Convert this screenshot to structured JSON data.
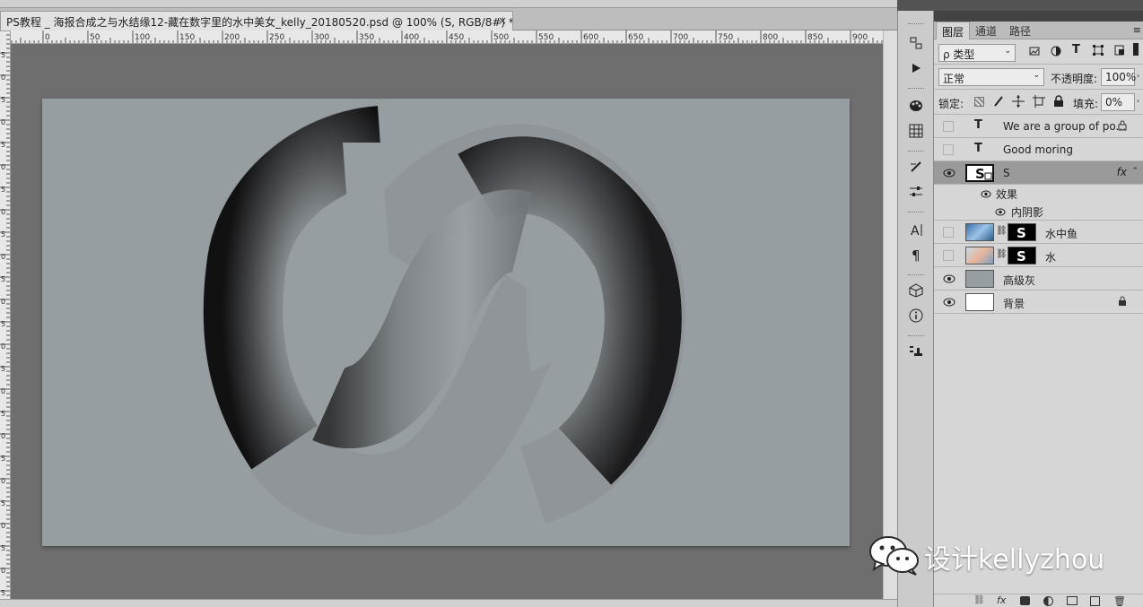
{
  "document": {
    "tab_title": "PS教程 _ 海报合成之与水结缘12-藏在数字里的水中美女_kelly_20180520.psd @ 100% (S, RGB/8#) *",
    "tab_close": "×"
  },
  "ruler": {
    "h_ticks": [
      "0",
      "50",
      "100",
      "150",
      "200",
      "250",
      "300",
      "350",
      "400",
      "450",
      "500",
      "550",
      "600",
      "650",
      "700",
      "750",
      "800",
      "850",
      "900"
    ],
    "v_ticks": [
      "5",
      "0",
      "5",
      "0",
      "5",
      "0",
      "5",
      "0",
      "5",
      "0",
      "5",
      "0",
      "5",
      "0",
      "5",
      "0",
      "5",
      "0",
      "5",
      "0",
      "5",
      "0",
      "5",
      "0",
      "5",
      "0"
    ]
  },
  "panel": {
    "tabs": [
      "图层",
      "通道",
      "路径"
    ],
    "filter_label": "ρ 类型",
    "blend_mode": "正常",
    "opacity_label": "不透明度:",
    "opacity_value": "100%",
    "lock_label": "锁定:",
    "fill_label": "填充:",
    "fill_value": "0%",
    "layers": [
      {
        "name": "We are a group of po...",
        "kind": "text",
        "visible": false,
        "locked": true
      },
      {
        "name": "Good moring",
        "kind": "text",
        "visible": false,
        "locked": false
      },
      {
        "name": "S",
        "kind": "smart",
        "visible": true,
        "selected": true,
        "fx": "fx"
      },
      {
        "name": "效果",
        "kind": "effects",
        "visible": true
      },
      {
        "name": "内阴影",
        "kind": "effect",
        "visible": true
      },
      {
        "name": "水中鱼",
        "kind": "masked",
        "visible": false
      },
      {
        "name": "水",
        "kind": "masked",
        "visible": false
      },
      {
        "name": "高级灰",
        "kind": "fill",
        "visible": true
      },
      {
        "name": "背景",
        "kind": "background",
        "visible": true,
        "locked": true
      }
    ]
  },
  "canvas": {
    "artboard_color": "#979ea2",
    "workspace_color": "#6e6e6e",
    "glyph": "S"
  },
  "watermark": {
    "text": "设计kellyzhou"
  },
  "colors": {
    "panel_bg": "#d6d6d6",
    "selected_layer": "#9a9a9a"
  }
}
